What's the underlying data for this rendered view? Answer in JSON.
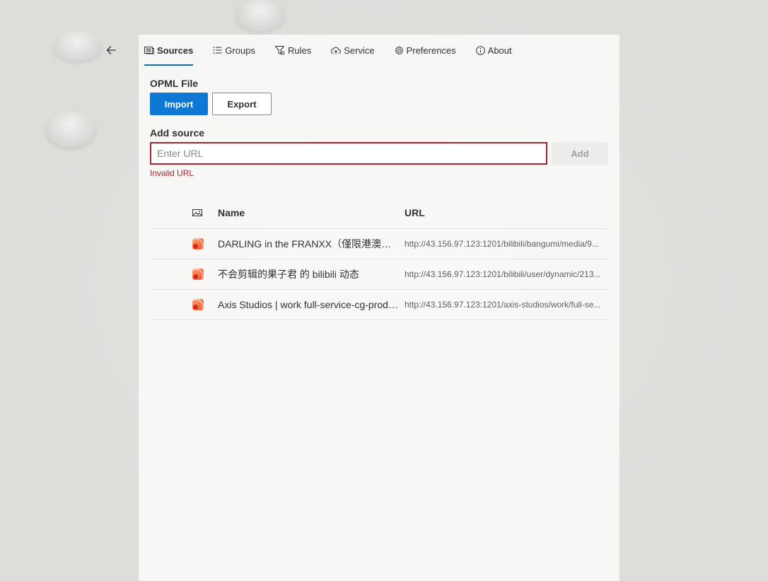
{
  "nav": {
    "back_label": "Back",
    "tabs": [
      {
        "label": "Sources",
        "icon": "feed-icon",
        "active": true
      },
      {
        "label": "Groups",
        "icon": "list-icon",
        "active": false
      },
      {
        "label": "Rules",
        "icon": "filter-icon",
        "active": false
      },
      {
        "label": "Service",
        "icon": "cloud-icon",
        "active": false
      },
      {
        "label": "Preferences",
        "icon": "gear-icon",
        "active": false
      },
      {
        "label": "About",
        "icon": "info-icon",
        "active": false
      }
    ]
  },
  "opml": {
    "label": "OPML File",
    "import_label": "Import",
    "export_label": "Export"
  },
  "add_source": {
    "label": "Add source",
    "placeholder": "Enter URL",
    "value": "",
    "add_label": "Add",
    "error": "Invalid URL"
  },
  "table": {
    "headers": {
      "icon": "image-icon",
      "name": "Name",
      "url": "URL"
    },
    "rows": [
      {
        "icon": "rss-icon",
        "name": "DARLING in the FRANXX（僅限港澳台地區）",
        "url": "http://43.156.97.123:1201/bilibili/bangumi/media/9..."
      },
      {
        "icon": "rss-icon",
        "name": "不会剪辑的果子君 的 bilibili 动态",
        "url": "http://43.156.97.123:1201/bilibili/user/dynamic/213..."
      },
      {
        "icon": "rss-icon",
        "name": "Axis Studios | work full-service-cg-production",
        "url": "http://43.156.97.123:1201/axis-studios/work/full-se..."
      }
    ]
  },
  "colors": {
    "accent": "#0f6cbd",
    "primary_button": "#0f78d4",
    "error": "#a4262c"
  }
}
